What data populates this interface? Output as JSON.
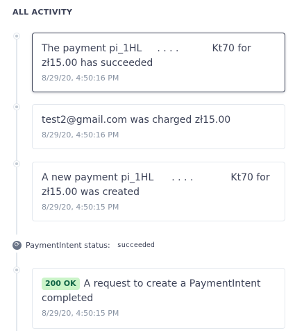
{
  "section": {
    "title": "ALL ACTIVITY"
  },
  "events": [
    {
      "line1_pre": "The payment pi_1HL",
      "dots": ". . . .",
      "line1_post": "Kt70 for",
      "line2": "zł15.00 has succeeded",
      "time": "8/29/20, 4:50:16 PM"
    },
    {
      "text": "test2@gmail.com was charged zł15.00",
      "time": "8/29/20, 4:50:16 PM"
    },
    {
      "line1_pre": "A new payment pi_1HL",
      "dots": ". . . .",
      "line1_post": "Kt70 for",
      "line2": "zł15.00 was created",
      "time": "8/29/20, 4:50:15 PM"
    }
  ],
  "status": {
    "icon": "paymentintent-icon",
    "label": "PaymentIntent status:",
    "value": "succeeded"
  },
  "request": {
    "badge": "200 OK",
    "text_line1": "A request to create a PaymentIntent",
    "text_line2": "completed",
    "time": "8/29/20, 4:50:15 PM"
  }
}
